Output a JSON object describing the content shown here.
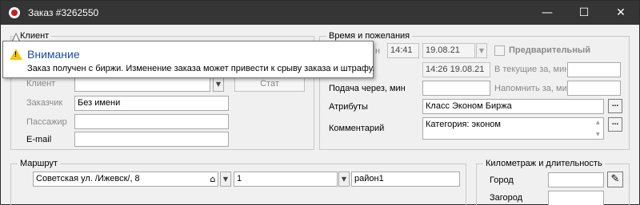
{
  "window": {
    "title": "Заказ #3262550",
    "minimize": "—",
    "maximize": "☐",
    "close": "✕"
  },
  "client": {
    "group_title": "Клиент",
    "client_label": "Клиент",
    "client_value": "",
    "stat_button": "Стат",
    "customer_label": "Заказчик",
    "customer_value": "Без имени",
    "passenger_label": "Пассажир",
    "passenger_value": "",
    "email_label": "E-mail",
    "email_value": ""
  },
  "time": {
    "group_title": "Время и пожелания",
    "time_label_partial": "н",
    "time_value": "14:41",
    "date_value": "19.08.21",
    "preliminary_label": "Предварительный",
    "created_value": "14:26 19.08.21",
    "current_within_label": "В текущие за, мин",
    "current_within_value": "",
    "submit_in_label": "Подача через, мин",
    "submit_in_value": "",
    "remind_label": "Напомнить за, мин",
    "remind_value": "",
    "attributes_label": "Атрибуты",
    "attributes_value": "Класс Эконом Биржа",
    "attributes_button": "...",
    "comment_label": "Комментарий",
    "comment_value": "Категория: эконом",
    "comment_button": "..."
  },
  "route": {
    "group_title": "Маршрут",
    "address_value": "Советская ул. /Ижевск/, 8",
    "house_value": "1",
    "district_value": "район1"
  },
  "mileage": {
    "group_title": "Километраж и длительность",
    "city_label": "Город",
    "city_value": "",
    "suburb_label": "Загород",
    "suburb_value": ""
  },
  "tooltip": {
    "title": "Внимание",
    "message": "Заказ получен с биржи. Изменение заказа может привести к срыву заказа и штрафу."
  },
  "colors": {
    "titlebar": "#353535",
    "tooltip_title": "#1c4e9a",
    "warning": "#f2c511"
  },
  "icons": {
    "app": "app-icon",
    "warning": "warning-icon",
    "home": "home-icon",
    "pencil": "pencil-icon",
    "dropdown": "chevron-down-icon"
  }
}
